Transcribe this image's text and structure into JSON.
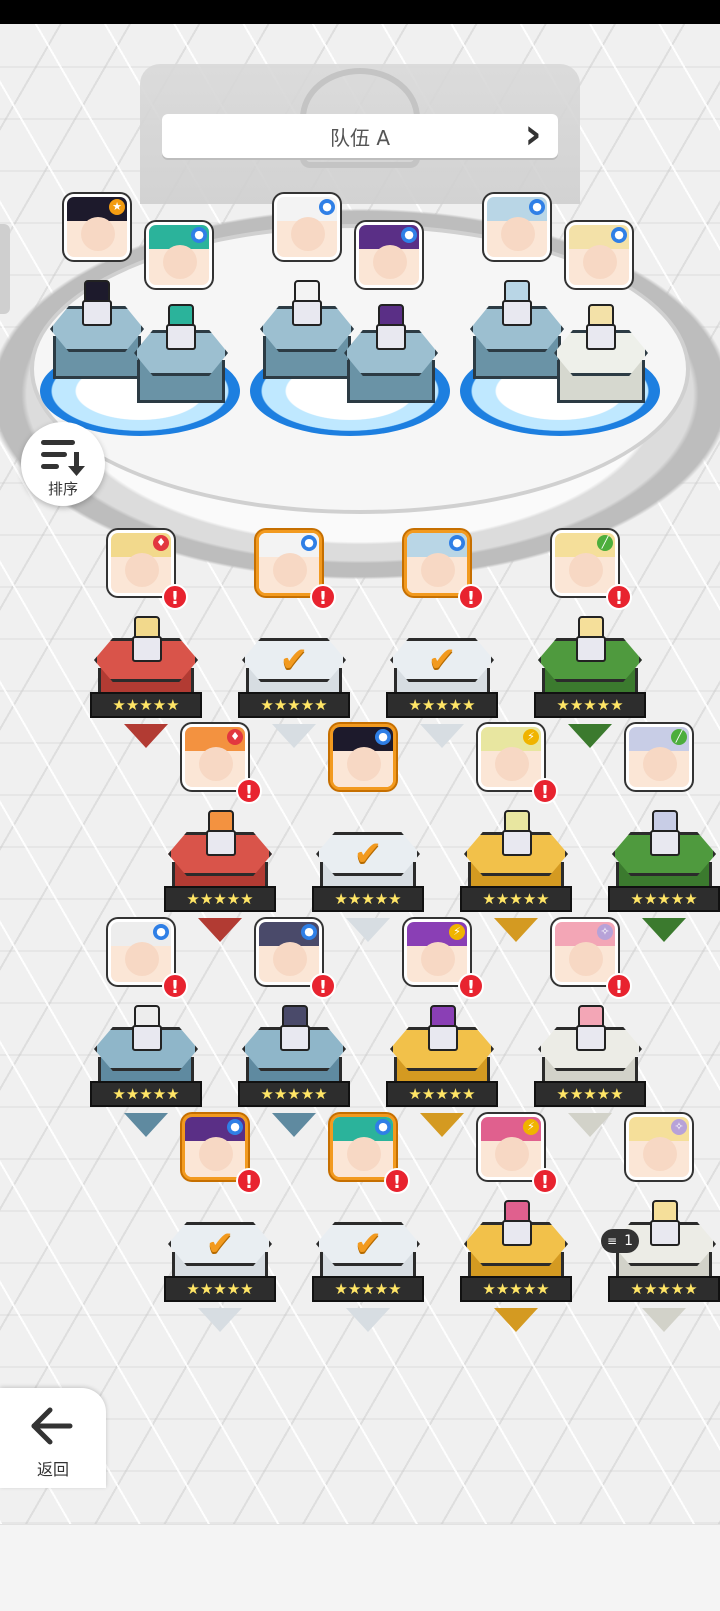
{
  "team": {
    "name": "队伍 A",
    "prev_icon": "chevron-left-icon",
    "next_icon": "chevron-right-icon"
  },
  "sort": {
    "label": "排序",
    "icon": "sort-descending-icon"
  },
  "back": {
    "label": "返回",
    "icon": "arrow-left-icon"
  },
  "count_badge": {
    "value": "1",
    "icon": "stack-icon"
  },
  "colors": {
    "selected_border": "#f29a1f",
    "alert_red": "#e8232f",
    "element_blue": "#2f7fe6",
    "element_red": "#e2373f",
    "element_green": "#4cae3c",
    "element_yellow": "#f0b400",
    "element_light": "#b7a2d8",
    "element_star": "#f39c12"
  },
  "team_slots": [
    {
      "element": "star",
      "hair": "#1d1a2c",
      "pedestal": "blue"
    },
    {
      "element": "blue",
      "hair": "#2bb39b",
      "pedestal": "blue"
    },
    {
      "element": "blue",
      "hair": "#f3f3f3",
      "pedestal": "blue"
    },
    {
      "element": "blue",
      "hair": "#5a2f86",
      "pedestal": "blue"
    },
    {
      "element": "blue",
      "hair": "#b9d6e6",
      "pedestal": "blue"
    },
    {
      "element": "blue",
      "hair": "#f3e1a8",
      "pedestal": "white"
    }
  ],
  "roster": [
    {
      "element": "red",
      "hair": "#f2d98c",
      "pillar": "red",
      "stars": "★★★★★",
      "selected": false,
      "alert": "!"
    },
    {
      "element": "blue",
      "hair": "#f3f3f3",
      "pillar": "glass",
      "stars": "★★★★★",
      "selected": true,
      "alert": "!"
    },
    {
      "element": "blue",
      "hair": "#b9d6e6",
      "pillar": "glass",
      "stars": "★★★★★",
      "selected": true,
      "alert": "!"
    },
    {
      "element": "green",
      "hair": "#f5df9a",
      "pillar": "green",
      "stars": "★★★★★",
      "selected": false,
      "alert": "!"
    },
    {
      "element": "red",
      "hair": "#f39240",
      "pillar": "red",
      "stars": "★★★★★",
      "selected": false,
      "alert": "!"
    },
    {
      "element": "blue",
      "hair": "#1d1a2c",
      "pillar": "glass",
      "stars": "★★★★★",
      "selected": true,
      "alert": ""
    },
    {
      "element": "yellow",
      "hair": "#e8e6a0",
      "pillar": "yellow",
      "stars": "★★★★★",
      "selected": false,
      "alert": "!"
    },
    {
      "element": "green",
      "hair": "#c8cde6",
      "pillar": "green",
      "stars": "★★★★★",
      "selected": false,
      "alert": ""
    },
    {
      "element": "blue",
      "hair": "#ededed",
      "pillar": "blue",
      "stars": "★★★★★",
      "selected": false,
      "alert": "!"
    },
    {
      "element": "blue",
      "hair": "#4a4a6a",
      "pillar": "blue",
      "stars": "★★★★★",
      "selected": false,
      "alert": "!"
    },
    {
      "element": "yellow",
      "hair": "#8a3fb5",
      "pillar": "yellow",
      "stars": "★★★★★",
      "selected": false,
      "alert": "!"
    },
    {
      "element": "light",
      "hair": "#f3a6b6",
      "pillar": "white",
      "stars": "★★★★★",
      "selected": false,
      "alert": "!"
    },
    {
      "element": "blue",
      "hair": "#5a2f86",
      "pillar": "glass",
      "stars": "★★★★★",
      "selected": true,
      "alert": "!"
    },
    {
      "element": "blue",
      "hair": "#2bb39b",
      "pillar": "glass",
      "stars": "★★★★★",
      "selected": true,
      "alert": "!"
    },
    {
      "element": "yellow",
      "hair": "#e0608e",
      "pillar": "yellow",
      "stars": "★★★★★",
      "selected": false,
      "alert": "!"
    },
    {
      "element": "light",
      "hair": "#f5df9a",
      "pillar": "white",
      "stars": "★★★★★",
      "selected": false,
      "alert": ""
    }
  ]
}
